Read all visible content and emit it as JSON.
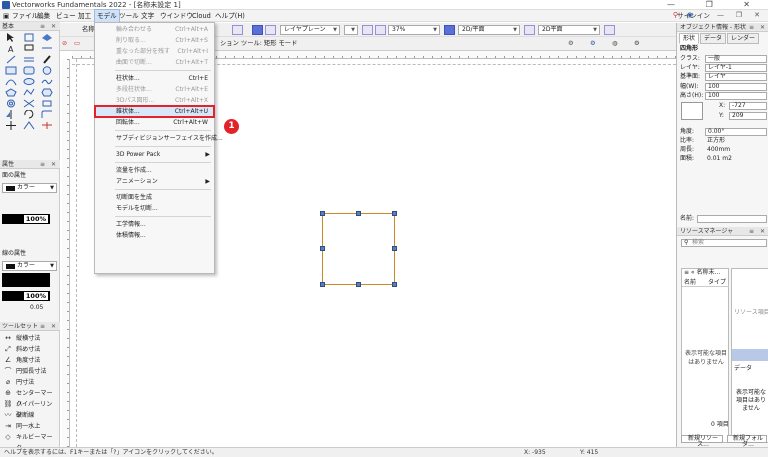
{
  "window": {
    "title": "Vectorworks Fundamentals 2022 - [名称未設定 1]",
    "controls": "— ❐ ✕"
  },
  "menubar": {
    "items": [
      "ファイル",
      "編集",
      "ビュー",
      "加工",
      "モデル",
      "ツール",
      "文字",
      "ウインドウ",
      "Cloud",
      "ヘルプ(H)"
    ],
    "active_index": 4,
    "signin": "サインイン"
  },
  "toolbar": {
    "class_label": "名称",
    "layer_value": "レイヤプレーン",
    "zoom_value": "37%",
    "view_value": "2D/平面",
    "render_value": "2D平面",
    "mode_text": "ション ツール: 矩形 モード"
  },
  "left_palette": {
    "basic_title": "基本",
    "attr_title": "属性",
    "fill_label": "面の属性",
    "fill_type": "カラー",
    "fill_opacity": "100%",
    "line_label": "線の属性",
    "line_type": "カラー",
    "line_opacity": "100%",
    "line_weight": "0.05",
    "toolset_title": "ツールセット",
    "toolset_items": [
      {
        "label": "縦横寸法",
        "icon": "↔"
      },
      {
        "label": "斜め寸法",
        "icon": "⤢"
      },
      {
        "label": "角度寸法",
        "icon": "∠"
      },
      {
        "label": "円弧長寸法",
        "icon": "⌒"
      },
      {
        "label": "円寸法",
        "icon": "⌀"
      },
      {
        "label": "センターマーク",
        "icon": "⊕"
      },
      {
        "label": "ハイパーリンク",
        "icon": "⛓"
      },
      {
        "label": "破断線",
        "icon": "〰"
      },
      {
        "label": "同一水上",
        "icon": "⇥"
      },
      {
        "label": "キルビーマーク",
        "icon": "◇"
      }
    ]
  },
  "model_menu": {
    "items": [
      {
        "label": "輪み合わせる",
        "shortcut": "Ctrl+Alt+A",
        "enabled": false
      },
      {
        "label": "削り取る...",
        "shortcut": "Ctrl+Alt+S",
        "enabled": false
      },
      {
        "label": "重なった部分を残す",
        "shortcut": "Ctrl+Alt+I",
        "enabled": false
      },
      {
        "label": "曲面で切断...",
        "shortcut": "Ctrl+Alt+T",
        "enabled": false
      },
      {
        "sep": true
      },
      {
        "label": "柱状体...",
        "shortcut": "Ctrl+E",
        "enabled": true
      },
      {
        "label": "多段柱状体...",
        "shortcut": "Ctrl+Alt+E",
        "enabled": false
      },
      {
        "label": "3Dパス図形...",
        "shortcut": "Ctrl+Alt+X",
        "enabled": false
      },
      {
        "label": "錐状体...",
        "shortcut": "Ctrl+Alt+U",
        "enabled": true,
        "highlighted": true
      },
      {
        "label": "回転体...",
        "shortcut": "Ctrl+Alt+W",
        "enabled": true
      },
      {
        "sep": true
      },
      {
        "label": "サブディビジョンサーフェイスを作成...",
        "shortcut": "",
        "enabled": true
      },
      {
        "sep": true
      },
      {
        "label": "3D Power Pack",
        "shortcut": "",
        "enabled": true,
        "submenu": true
      },
      {
        "sep": true
      },
      {
        "label": "流量を作成...",
        "shortcut": "",
        "enabled": true
      },
      {
        "label": "アニメーション",
        "shortcut": "",
        "enabled": true,
        "submenu": true
      },
      {
        "sep": true
      },
      {
        "label": "切断面を生成",
        "shortcut": "",
        "enabled": true
      },
      {
        "label": "モデルを切断...",
        "shortcut": "",
        "enabled": true
      },
      {
        "sep": true
      },
      {
        "label": "工学情報...",
        "shortcut": "",
        "enabled": true
      },
      {
        "label": "体積情報...",
        "shortcut": "",
        "enabled": true
      }
    ]
  },
  "step_badge": "1",
  "obj_info": {
    "title": "オブジェクト情報 - 形状",
    "tabs": [
      "形状",
      "データ",
      "レンダー"
    ],
    "shape": "四角形",
    "class_label": "クラス:",
    "class_value": "一般",
    "layer_label": "レイヤ:",
    "layer_value": "レイヤ-1",
    "plane_label": "基準面:",
    "plane_value": "レイヤ",
    "width_label": "幅(W):",
    "width_value": "100",
    "height_label": "高さ(H):",
    "height_value": "100",
    "x_label": "X:",
    "x_value": "-727",
    "y_label": "Y:",
    "y_value": "209",
    "angle_label": "角度:",
    "angle_value": "0.00°",
    "ratio_label": "比率:",
    "ratio_value": "正方形",
    "perimeter_label": "周長:",
    "perimeter_value": "400mm",
    "area_label": "面積:",
    "area_value": "0.01 m2",
    "name_label": "名前:"
  },
  "resource": {
    "title": "リソースマネージャ",
    "search_placeholder": "検索",
    "folder_label": "名称未...",
    "col_name": "名前",
    "col_type": "タイプ",
    "empty_msg": "表示可能な項目はありません",
    "right_msg": "リソース項目が",
    "data_label": "データ",
    "data_msg": "表示可能な項目はありません",
    "count": "0 項目",
    "new_btn": "新規リソース...",
    "new_folder_btn": "新規フォルダ..."
  },
  "status": {
    "help": "ヘルプを表示するには、F1キーまたは「?」アイコンをクリックしてください。",
    "x": "X: -935",
    "y": "Y: 415"
  }
}
